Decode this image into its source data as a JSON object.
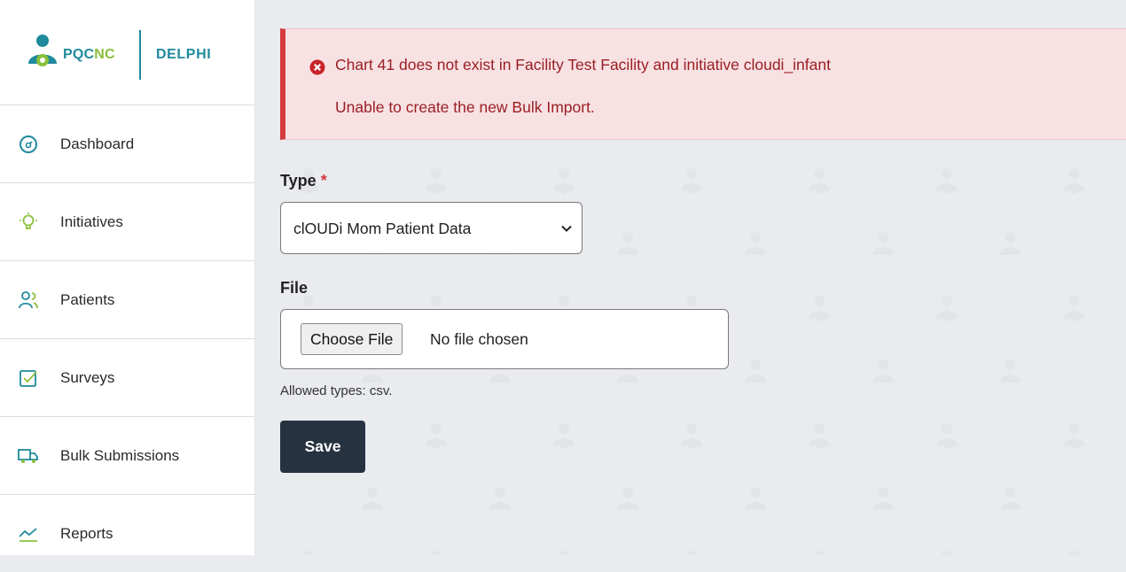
{
  "brand": {
    "name_part1": "PQC",
    "name_part2": "NC",
    "product": "DELPHI"
  },
  "sidebar": {
    "items": [
      {
        "label": "Dashboard",
        "icon": "dashboard-gauge-icon"
      },
      {
        "label": "Initiatives",
        "icon": "lightbulb-icon"
      },
      {
        "label": "Patients",
        "icon": "users-icon"
      },
      {
        "label": "Surveys",
        "icon": "checkbox-icon"
      },
      {
        "label": "Bulk Submissions",
        "icon": "truck-icon"
      },
      {
        "label": "Reports",
        "icon": "chart-line-icon"
      }
    ]
  },
  "alert": {
    "line1": "Chart 41 does not exist in Facility Test Facility and initiative cloudi_infant",
    "line2": "Unable to create the new Bulk Import.",
    "color": "#9a1f24"
  },
  "form": {
    "type_label": "Type",
    "required_mark": "*",
    "type_value": "clOUDi Mom Patient Data",
    "file_label": "File",
    "file_button": "Choose File",
    "file_status": "No file chosen",
    "help": "Allowed types: csv.",
    "save": "Save"
  },
  "colors": {
    "accent": "#1f8a9c",
    "brand_green": "#8bbf3c",
    "danger": "#d43a3f",
    "save_bg": "#263240"
  }
}
